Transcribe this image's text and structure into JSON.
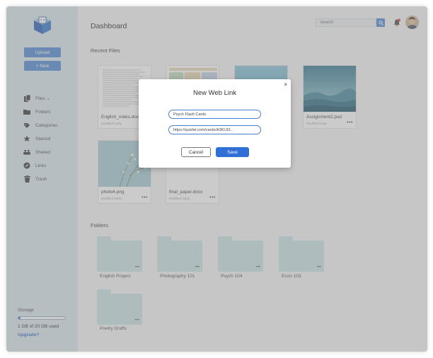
{
  "sidebar": {
    "upload_label": "Upload",
    "new_label": "+ New",
    "items": [
      {
        "label": "Files ⌄",
        "icon": "files-icon"
      },
      {
        "label": "Folders",
        "icon": "folder-icon"
      },
      {
        "label": "Categories",
        "icon": "categories-icon"
      },
      {
        "label": "Starred",
        "icon": "star-icon"
      },
      {
        "label": "Shared",
        "icon": "shared-icon"
      },
      {
        "label": "Links",
        "icon": "link-icon"
      },
      {
        "label": "Trash",
        "icon": "trash-icon"
      }
    ],
    "storage_label": "Storage",
    "storage_used_fraction": 0.05,
    "storage_text": "1 GB of 20 GB used",
    "upgrade_label": "Upgrade?"
  },
  "header": {
    "title": "Dashboard",
    "search_placeholder": "Search"
  },
  "recent_files": {
    "title": "Recent Files",
    "files": [
      {
        "name": "English_notes.docx",
        "meta": "Modified today"
      },
      {
        "name": "",
        "meta": ""
      },
      {
        "name": "",
        "meta": ""
      },
      {
        "name": "Assignment2.psd",
        "meta": "Modified today"
      },
      {
        "name": "photo4.png",
        "meta": "Modified today"
      },
      {
        "name": "final_paper.docx",
        "meta": "Modified today"
      }
    ]
  },
  "folders": {
    "title": "Folders",
    "items": [
      "English Project",
      "Photography 101",
      "Psych 104",
      "Econ 103",
      "Poetry Drafts"
    ]
  },
  "modal": {
    "title": "New Web Link",
    "name_value": "Psych Flash Cards",
    "url_value": "https://quizlet.com/cards/A3KL93...",
    "cancel_label": "Cancel",
    "save_label": "Save",
    "close_glyph": "×"
  },
  "colors": {
    "accent": "#5b8fd6",
    "save": "#2f6fd6",
    "sidebar": "#dbe8f0",
    "folder": "#cde6e8"
  }
}
